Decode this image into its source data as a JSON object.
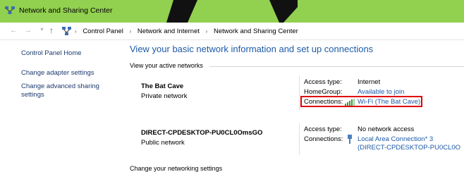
{
  "window": {
    "title": "Network and Sharing Center",
    "title_bar_color": "#92d050"
  },
  "address_bar": {
    "breadcrumbs": [
      "Control Panel",
      "Network and Internet",
      "Network and Sharing Center"
    ],
    "separator": "›"
  },
  "sidebar": {
    "home_link": "Control Panel Home",
    "links": [
      "Change adapter settings",
      "Change advanced sharing settings"
    ]
  },
  "main": {
    "heading": "View your basic network information and set up connections",
    "section_label": "View your active networks",
    "networks": [
      {
        "name": "The Bat Cave",
        "type": "Private network",
        "access_type_label": "Access type:",
        "access_type": "Internet",
        "homegroup_label": "HomeGroup:",
        "homegroup": "Available to join",
        "connections_label": "Connections:",
        "connections": "Wi-Fi (The Bat Cave)",
        "connection_icon": "wifi-signal-icon",
        "highlighted": true,
        "highlight_color": "#e00000"
      },
      {
        "name": "DIRECT-CPDESKTOP-PU0CL0OmsGO",
        "type": "Public network",
        "access_type_label": "Access type:",
        "access_type": "No network access",
        "connections_label": "Connections:",
        "connections_line1": "Local Area Connection* 3",
        "connections_line2": "(DIRECT-CPDESKTOP-PU0CL0O",
        "connection_icon": "ethernet-icon"
      }
    ],
    "bottom_text": "Change your networking settings"
  },
  "colors": {
    "link": "#1e5aa8",
    "sidebar_link": "#1e3a6e"
  }
}
